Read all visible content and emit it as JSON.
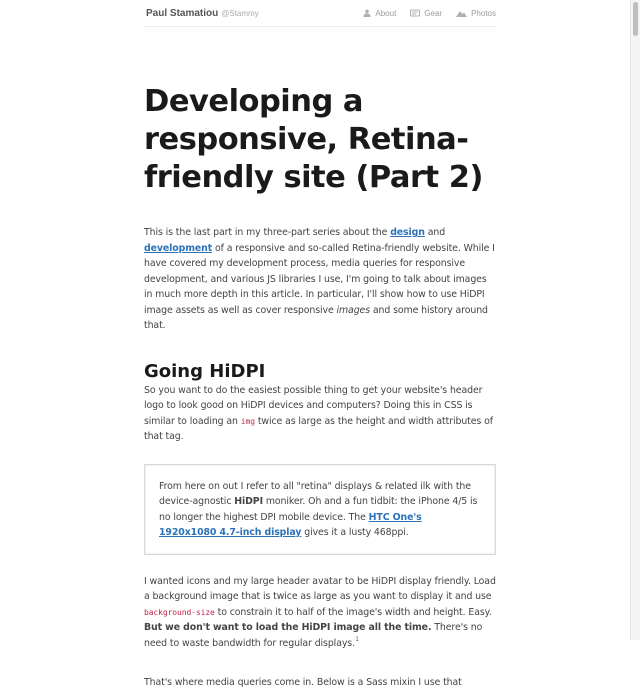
{
  "header": {
    "name": "Paul Stamatiou",
    "handle": "@Stammy",
    "nav": [
      {
        "label": "About",
        "icon": "user-icon"
      },
      {
        "label": "Gear",
        "icon": "gear-icon"
      },
      {
        "label": "Photos",
        "icon": "mountain-icon"
      }
    ]
  },
  "article": {
    "title": "Developing a responsive, Retina-friendly site (Part 2)",
    "intro": {
      "t1": "This is the last part in my three-part series about the ",
      "link_design": "design",
      "t2": " and ",
      "link_development": "development",
      "t3": " of a responsive and so-called Retina-friendly website. While I have covered my development process, media queries for responsive development, and various JS libraries I use, I'm going to talk about images in much more depth in this article. In particular, I'll show how to use HiDPI image assets as well as cover responsive ",
      "em": "images",
      "t4": " and some history around that."
    },
    "section_heading": "Going HiDPI",
    "p2": {
      "t1": "So you want to do the easiest possible thing to get your website's header logo to look good on HiDPI devices and computers? Doing this in CSS is similar to loading an ",
      "code": "img",
      "t2": " twice as large as the height and width attributes of that tag."
    },
    "callout": {
      "t1": "From here on out I refer to all \"retina\" displays & related ilk with the device-agnostic ",
      "strong": "HiDPI",
      "t2": " moniker. Oh and a fun tidbit: the iPhone 4/5 is no longer the highest DPI mobile device. The ",
      "link": "HTC One's 1920x1080 4.7-inch display",
      "t3": " gives it a lusty 468ppi."
    },
    "p3": {
      "t1": "I wanted icons and my large header avatar to be HiDPI display friendly. Load a background image that is twice as large as you want to display it and use ",
      "code": "background-size",
      "t2": " to constrain it to half of the image's width and height. Easy. ",
      "strong": "But we don't want to load the HiDPI image all the time.",
      "t3": " There's no need to waste bandwidth for regular displays.",
      "footnote": "1"
    },
    "p4_partial": "That's where media queries come in. Below is a Sass mixin I use that"
  },
  "colors": {
    "link": "#2b72b8",
    "code": "#c7254e",
    "heading": "#1a1a1a",
    "body": "#444444"
  }
}
